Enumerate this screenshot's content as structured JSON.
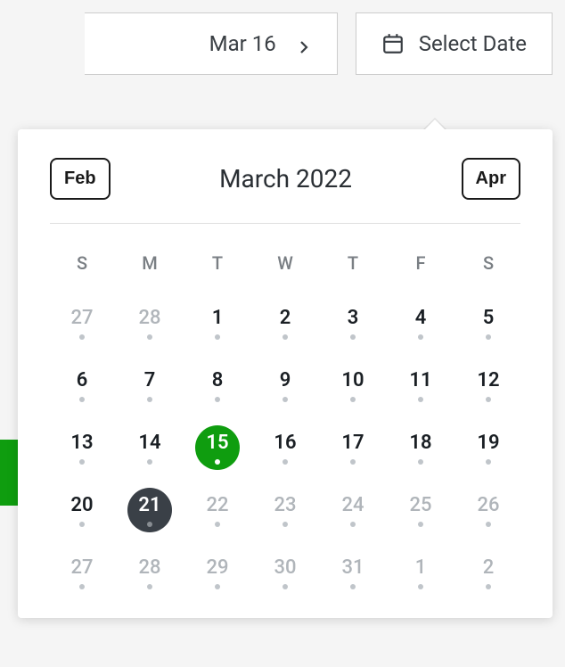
{
  "topbar": {
    "current_date_label": "Mar 16",
    "select_button_label": "Select Date"
  },
  "calendar": {
    "prev_month_label": "Feb",
    "next_month_label": "Apr",
    "title": "March 2022",
    "day_headers": [
      "S",
      "M",
      "T",
      "W",
      "T",
      "F",
      "S"
    ],
    "days": [
      [
        {
          "n": 27,
          "muted": true,
          "dot": true
        },
        {
          "n": 28,
          "muted": true,
          "dot": true
        },
        {
          "n": 1,
          "dot": true
        },
        {
          "n": 2,
          "dot": true
        },
        {
          "n": 3,
          "dot": true
        },
        {
          "n": 4,
          "dot": true
        },
        {
          "n": 5,
          "dot": true
        }
      ],
      [
        {
          "n": 6,
          "dot": true
        },
        {
          "n": 7,
          "dot": true
        },
        {
          "n": 8,
          "dot": true
        },
        {
          "n": 9,
          "dot": true
        },
        {
          "n": 10,
          "dot": true
        },
        {
          "n": 11,
          "dot": true
        },
        {
          "n": 12,
          "dot": true
        }
      ],
      [
        {
          "n": 13,
          "dot": true
        },
        {
          "n": 14,
          "dot": true
        },
        {
          "n": 15,
          "selected": true,
          "dot": true
        },
        {
          "n": 16,
          "dot": true
        },
        {
          "n": 17,
          "dot": true
        },
        {
          "n": 18,
          "dot": true
        },
        {
          "n": 19,
          "dot": true
        }
      ],
      [
        {
          "n": 20,
          "dot": true
        },
        {
          "n": 21,
          "today": true,
          "dot": true
        },
        {
          "n": 22,
          "muted": true,
          "dot": true
        },
        {
          "n": 23,
          "muted": true,
          "dot": true
        },
        {
          "n": 24,
          "muted": true,
          "dot": true
        },
        {
          "n": 25,
          "muted": true,
          "dot": true
        },
        {
          "n": 26,
          "muted": true,
          "dot": true
        }
      ],
      [
        {
          "n": 27,
          "muted": true,
          "dot": true
        },
        {
          "n": 28,
          "muted": true,
          "dot": true
        },
        {
          "n": 29,
          "muted": true,
          "dot": true
        },
        {
          "n": 30,
          "muted": true,
          "dot": true
        },
        {
          "n": 31,
          "muted": true,
          "dot": true
        },
        {
          "n": 1,
          "muted": true,
          "dot": true
        },
        {
          "n": 2,
          "muted": true,
          "dot": true
        }
      ]
    ]
  }
}
